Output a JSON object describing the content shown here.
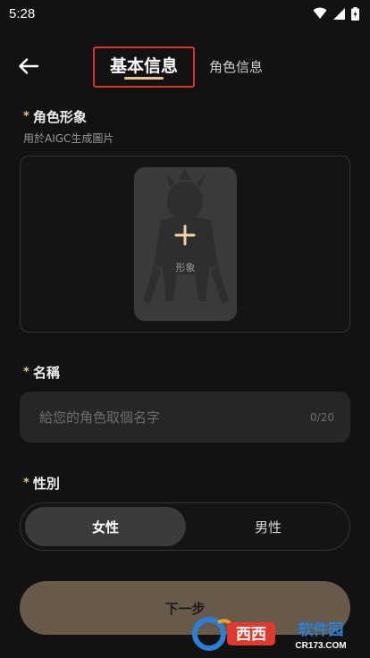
{
  "status_bar": {
    "time": "5:28",
    "icons": [
      "wifi-icon",
      "signal-icon",
      "battery-icon"
    ]
  },
  "header": {
    "back_icon": "arrow-left-icon",
    "tab_basic": "基本信息",
    "tab_role": "角色信息",
    "active_tab": "基本信息"
  },
  "avatar_section": {
    "required_mark": "*",
    "label": "角色形象",
    "subtext": "用於AIGC生成圖片",
    "add_icon": "plus-icon",
    "card_caption": "形象"
  },
  "name_section": {
    "required_mark": "*",
    "label": "名稱",
    "placeholder": "給您的角色取個名字",
    "value": "",
    "counter": "0/20"
  },
  "gender_section": {
    "required_mark": "*",
    "label": "性別",
    "options": [
      "女性",
      "男性"
    ],
    "selected": "女性"
  },
  "next_button": "下一步",
  "watermark_text": "西西软件园 CR173.COM",
  "colors": {
    "background": "#121212",
    "accent": "#e8c48f",
    "button": "#675a4a",
    "highlight_border": "#d9352b"
  }
}
